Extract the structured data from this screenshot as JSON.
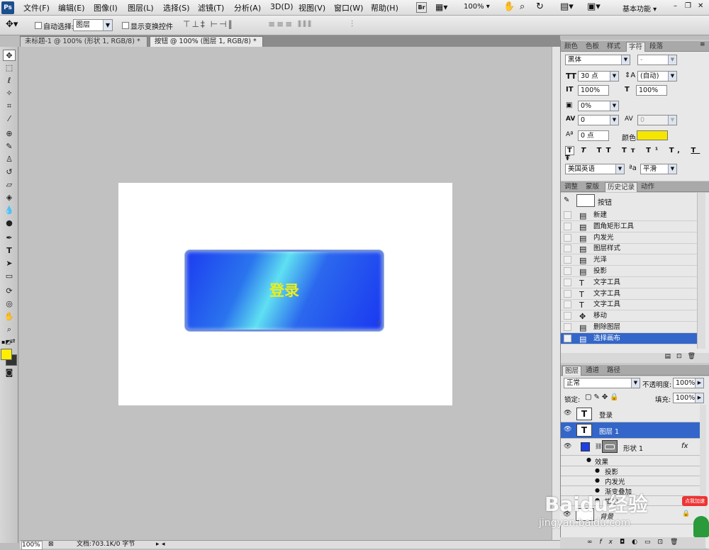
{
  "menubar": {
    "app_icon": "Ps",
    "items": [
      "文件(F)",
      "编辑(E)",
      "图像(I)",
      "图层(L)",
      "选择(S)",
      "滤镜(T)",
      "分析(A)",
      "3D(D)",
      "视图(V)",
      "窗口(W)",
      "帮助(H)"
    ],
    "bridge_label": "Br",
    "zoom": "100%",
    "workspace": "基本功能",
    "win_min": "–",
    "win_restore": "❐",
    "win_close": "✕"
  },
  "options": {
    "auto_select_label": "自动选择:",
    "auto_select_value": "图层",
    "show_transform_label": "显示变换控件"
  },
  "tabs": [
    "未标题-1 @ 100% (形状 1, RGB/8) *",
    "按钮 @ 100% (图层 1, RGB/8) *"
  ],
  "canvas": {
    "button_text": "登录"
  },
  "status": {
    "zoom": "100%",
    "doc_info": "文档:703.1K/0 字节"
  },
  "character_panel": {
    "tabs": [
      "颜色",
      "色板",
      "样式",
      "字符",
      "段落"
    ],
    "font_family": "黑体",
    "font_style": "-",
    "font_size": "30 点",
    "leading": "(自动)",
    "vscale": "100%",
    "hscale": "100%",
    "baseline_pct": "0%",
    "kerning": "0",
    "tracking": "0",
    "baseline_shift": "0 点",
    "color_label": "颜色:",
    "color": "#f5e600",
    "language": "美国英语",
    "aa_label": "ªa",
    "antialias": "平滑",
    "style_buttons": [
      "T",
      "T",
      "TT",
      "Tт",
      "T¹",
      "T,",
      "T",
      "Ŧ"
    ]
  },
  "history_panel": {
    "tabs": [
      "调整",
      "蒙版",
      "历史记录",
      "动作"
    ],
    "snapshot": "按钮",
    "items": [
      "新建",
      "圆角矩形工具",
      "内发光",
      "图层样式",
      "光泽",
      "投影",
      "文字工具",
      "文字工具",
      "文字工具",
      "移动",
      "删除图层",
      "选择画布"
    ],
    "selected_index": 11
  },
  "layers_panel": {
    "tabs": [
      "图层",
      "通道",
      "路径"
    ],
    "blend_mode": "正常",
    "opacity_label": "不透明度:",
    "opacity": "100%",
    "lock_label": "锁定:",
    "fill_label": "填充:",
    "fill": "100%",
    "layers": [
      {
        "name": "登录",
        "type": "text"
      },
      {
        "name": "图层 1",
        "type": "text",
        "selected": true
      },
      {
        "name": "形状 1",
        "type": "shape",
        "fx": "fx"
      }
    ],
    "effects_label": "效果",
    "effects": [
      "投影",
      "内发光",
      "渐变叠加",
      "描边"
    ],
    "background": "背景",
    "swatch_color": "#1e3fe6"
  },
  "watermark": {
    "brand": "Baidu经验",
    "url": "jingyan.baidu.com",
    "badge": "点我加速"
  },
  "colors": {
    "foreground": "#ffee00",
    "background": "#333333",
    "accent": "#3366c8"
  }
}
